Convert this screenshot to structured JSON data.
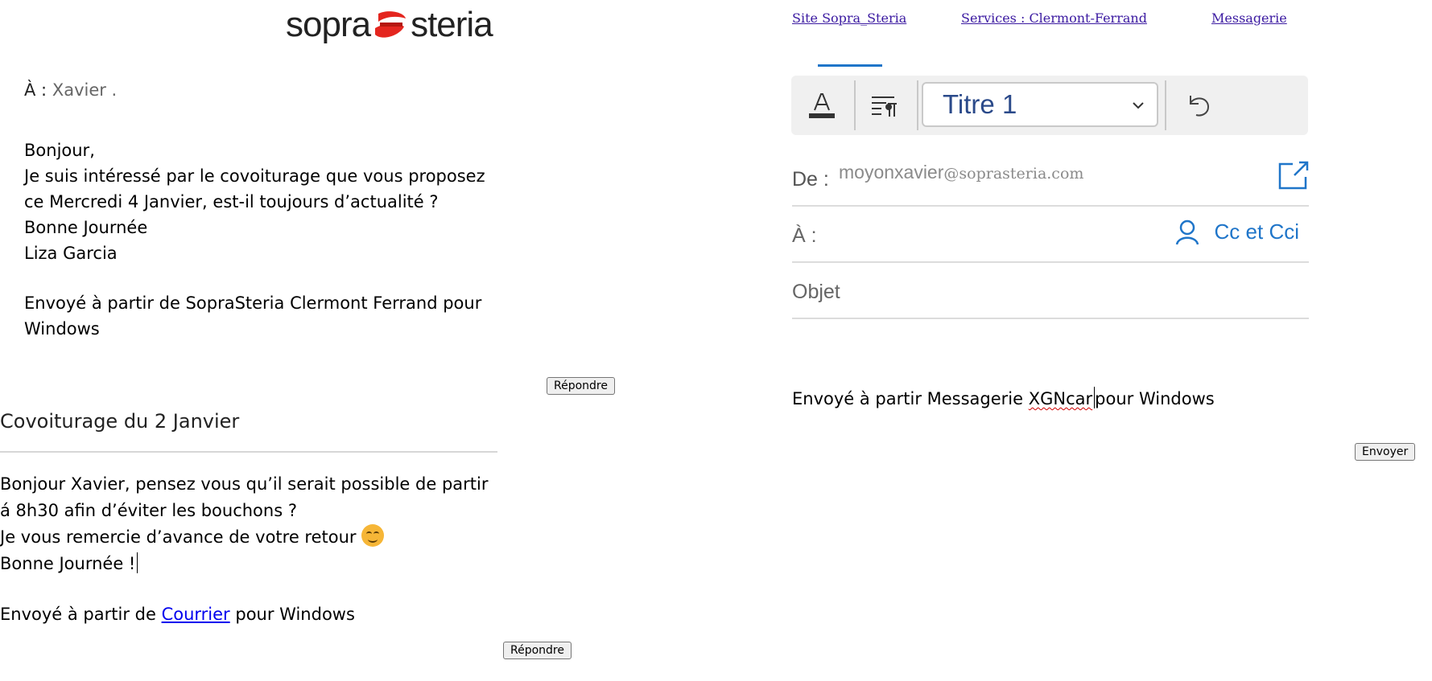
{
  "brand": {
    "part1": "sopra",
    "part2": "steria",
    "accent": "#e4261f"
  },
  "nav": [
    {
      "label": "Site Sopra_Steria"
    },
    {
      "label": "Services : Clermont-Ferrand"
    },
    {
      "label": "Messagerie"
    }
  ],
  "message1": {
    "to_label": "À :",
    "to_name": "Xavier .",
    "lines": [
      "Bonjour,",
      "Je suis intéressé par le covoiturage que vous proposez ce Mercredi 4 Janvier, est-il toujours d’actualité ?",
      "Bonne Journée",
      "Liza Garcia"
    ],
    "signature": "Envoyé à partir de SopraSteria Clermont Ferrand pour Windows",
    "reply_label": "Répondre"
  },
  "message2": {
    "subject": "Covoiturage du 2 Janvier",
    "line1": "Bonjour Xavier, pensez vous qu’il serait possible de partir á 8h30 afin d’éviter les bouchons ?",
    "line2": "Je vous remercie d’avance de votre retour",
    "line3": "Bonne Journée !",
    "signature_prefix": "Envoyé à partir de",
    "signature_link": "Courrier",
    "signature_suffix": "pour Windows",
    "reply_label": "Répondre"
  },
  "compose": {
    "style_value": "Titre 1",
    "from_label": "De :",
    "from_user": "moyonxavier",
    "from_domain": "@soprasteria.com",
    "to_label": "À :",
    "ccbcc_label": "Cc et Cci",
    "subject_placeholder": "Objet",
    "body_prefix": "Envoyé à partir Messagerie ",
    "body_app": "XGNcar",
    "body_suffix": "pour Windows",
    "send_label": "Envoyer",
    "accent": "#1f75c9"
  },
  "icons": [
    "font-color-icon",
    "paragraph-style-icon",
    "chevron-down-icon",
    "undo-icon",
    "popout-icon",
    "person-icon",
    "emoji-smile-icon",
    "sopra-steria-logo-icon"
  ]
}
